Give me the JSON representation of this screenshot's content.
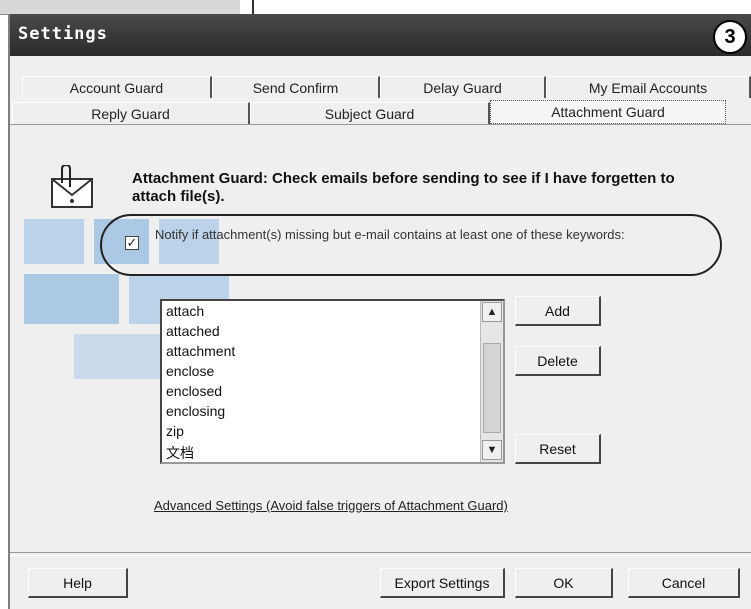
{
  "window": {
    "title": "Settings",
    "step_badge": "3"
  },
  "tabs": {
    "row1": [
      "Account Guard",
      "Send Confirm",
      "Delay Guard",
      "My Email Accounts"
    ],
    "row2": [
      "Reply Guard",
      "Subject Guard",
      "Attachment Guard"
    ],
    "active": "Attachment Guard"
  },
  "panel": {
    "heading": "Attachment Guard: Check emails before sending to see if I have forgetten to attach file(s).",
    "notify_checked": true,
    "notify_label": "Notify if attachment(s) missing but e-mail contains at least one of these keywords:",
    "keywords": [
      "attach",
      "attached",
      "attachment",
      "enclose",
      "enclosed",
      "enclosing",
      "zip",
      "文档"
    ],
    "add_label": "Add",
    "delete_label": "Delete",
    "reset_label": "Reset",
    "advanced_link": "Advanced Settings (Avoid false triggers of Attachment Guard)"
  },
  "footer": {
    "help_label": "Help",
    "export_label": "Export Settings",
    "ok_label": "OK",
    "cancel_label": "Cancel"
  },
  "colors": {
    "titlebar": "#333333",
    "dialog_bg": "#efefef",
    "watermark": "#4a90d9"
  }
}
